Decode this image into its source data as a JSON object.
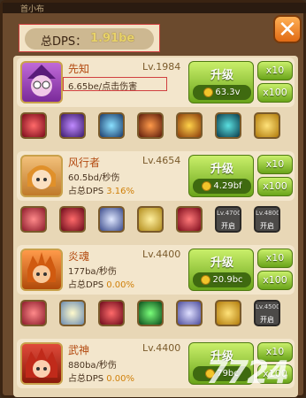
{
  "topbar": {
    "partial_text": "首小布"
  },
  "total_dps": {
    "label": "总DPS：",
    "value": "1.91be"
  },
  "heroes": [
    {
      "name": "先知",
      "level": "Lv.1984",
      "line1": "6.65be/点击伤害",
      "line2": "",
      "pct": "",
      "upgrade_label": "升级",
      "cost": "63.3v",
      "x10": "x10",
      "x100": "x100"
    },
    {
      "name": "风行者",
      "level": "Lv.4654",
      "line1": "60.5bd/秒伤",
      "line2": "占总DPS",
      "pct": "3.16%",
      "upgrade_label": "升级",
      "cost": "4.29bf",
      "x10": "x10",
      "x100": "x100"
    },
    {
      "name": "炎魂",
      "level": "Lv.4400",
      "line1": "177ba/秒伤",
      "line2": "占总DPS",
      "pct": "0.00%",
      "upgrade_label": "升级",
      "cost": "20.9bc",
      "x10": "x10",
      "x100": "x100"
    },
    {
      "name": "武神",
      "level": "Lv.4400",
      "line1": "880ba/秒伤",
      "line2": "占总DPS",
      "pct": "0.00%",
      "upgrade_label": "升级",
      "cost": "79bc",
      "x10": "x10",
      "x100": "x100"
    }
  ],
  "locked_skills": [
    {
      "level": "Lv.4700",
      "label": "开启"
    },
    {
      "level": "Lv.4800",
      "label": "开启"
    },
    {
      "level": "Lv.4500",
      "label": "开启"
    }
  ],
  "watermark": "7724",
  "colors": {
    "accent_green": "#7bbf2a",
    "dps_value": "#e8d36a",
    "name_orange": "#b34a10",
    "close_orange": "#e06a14"
  }
}
